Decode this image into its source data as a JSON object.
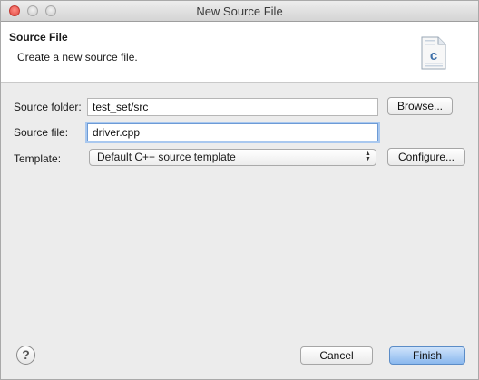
{
  "window": {
    "title": "New Source File"
  },
  "banner": {
    "title": "Source File",
    "subtitle": "Create a new source file.",
    "icon_letter": "c"
  },
  "form": {
    "source_folder": {
      "label": "Source folder:",
      "value": "test_set/src",
      "button": "Browse..."
    },
    "source_file": {
      "label": "Source file:",
      "value": "driver.cpp"
    },
    "template": {
      "label": "Template:",
      "selected": "Default C++ source template",
      "button": "Configure..."
    }
  },
  "footer": {
    "help_glyph": "?",
    "cancel": "Cancel",
    "finish": "Finish"
  },
  "colors": {
    "primary_button": "#8ab8ee",
    "focus_ring": "#a9c8ef",
    "close_light": "#e0443e"
  },
  "icons": [
    "close-icon",
    "minimize-icon",
    "maximize-icon",
    "c-source-file-icon",
    "help-icon",
    "updown-arrows-icon"
  ]
}
